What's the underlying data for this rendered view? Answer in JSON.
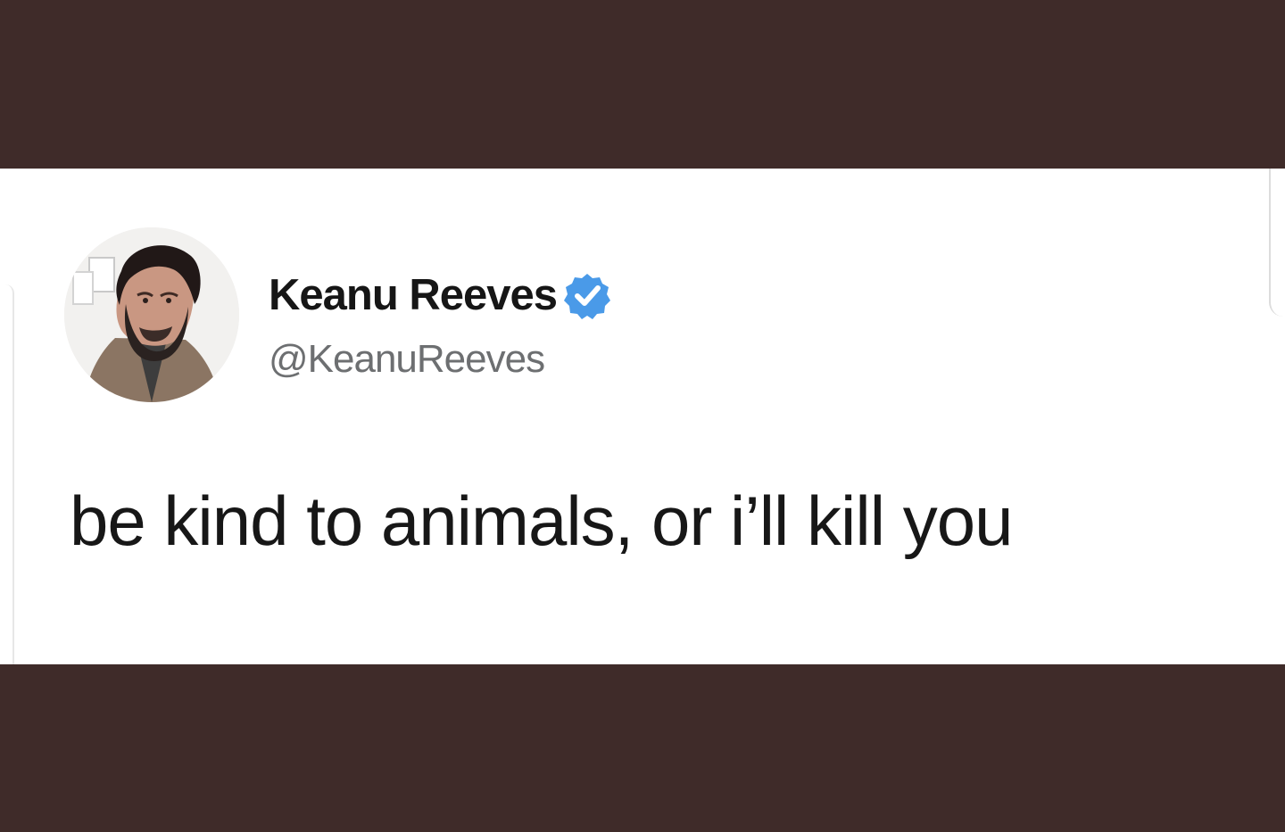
{
  "tweet": {
    "display_name": "Keanu Reeves",
    "username": "@KeanuReeves",
    "text": "be kind to animals, or i’ll kill you",
    "verified_icon": "verified-badge-icon",
    "avatar_icon": "profile-avatar"
  },
  "colors": {
    "background": "#3f2b29",
    "card": "#ffffff",
    "name": "#161616",
    "username": "#6d6f71",
    "text": "#171717",
    "verified": "#4a9ae8"
  }
}
